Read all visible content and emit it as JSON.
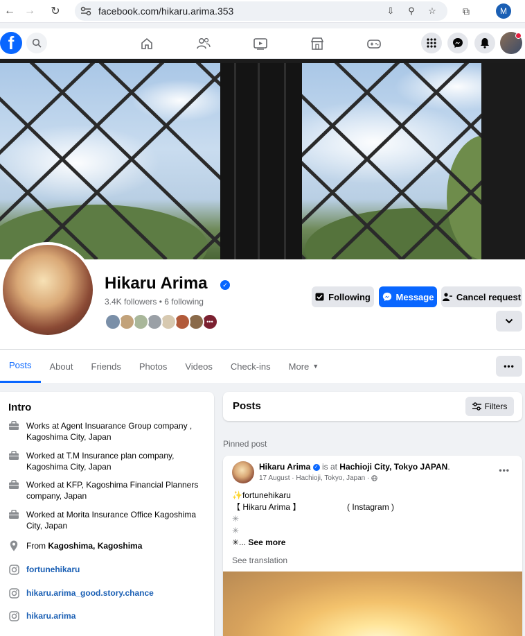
{
  "browser": {
    "url": "facebook.com/hikaru.arima.353",
    "profile_initial": "M"
  },
  "profile": {
    "name": "Hikaru Arima",
    "stats": "3.4K followers • 6 following",
    "buttons": {
      "following": "Following",
      "message": "Message",
      "cancel_request": "Cancel request"
    },
    "friend_colors": [
      "#7a8fa8",
      "#c2a27a",
      "#a9b79a",
      "#9aa0a6",
      "#d7c9b0",
      "#b25a3a",
      "#8a6a4a",
      "#7b2030"
    ]
  },
  "tabs": [
    {
      "label": "Posts",
      "active": true
    },
    {
      "label": "About"
    },
    {
      "label": "Friends"
    },
    {
      "label": "Photos"
    },
    {
      "label": "Videos"
    },
    {
      "label": "Check-ins"
    },
    {
      "label": "More"
    }
  ],
  "intro": {
    "title": "Intro",
    "work": [
      "Works at Agent Insuarance Group company , Kagoshima City, Japan",
      "Worked at T.M Insurance plan company, Kagoshima City, Japan",
      "Worked at KFP, Kagoshima Financial Planners company, Japan",
      "Worked at Morita Insurance Office Kagoshima City, Japan"
    ],
    "from_prefix": "From",
    "from_place": "Kagoshima, Kagoshima",
    "links": [
      "fortunehikaru",
      "hikaru.arima_good.story.chance",
      "hikaru.arima"
    ]
  },
  "posts": {
    "title": "Posts",
    "filters_label": "Filters",
    "pinned_label": "Pinned post"
  },
  "post": {
    "author": "Hikaru Arima",
    "is_at": "is at",
    "place": "Hachioji City, Tokyo JAPAN",
    "meta": "17 August · Hachioji, Tokyo, Japan ·",
    "lines": [
      "✨fortunehikaru",
      "【 Hikaru Arima 】                    ( Instagram )",
      "✳",
      "✳"
    ],
    "last_line_prefix": "✳...",
    "see_more": "See more",
    "see_translation": "See translation"
  }
}
